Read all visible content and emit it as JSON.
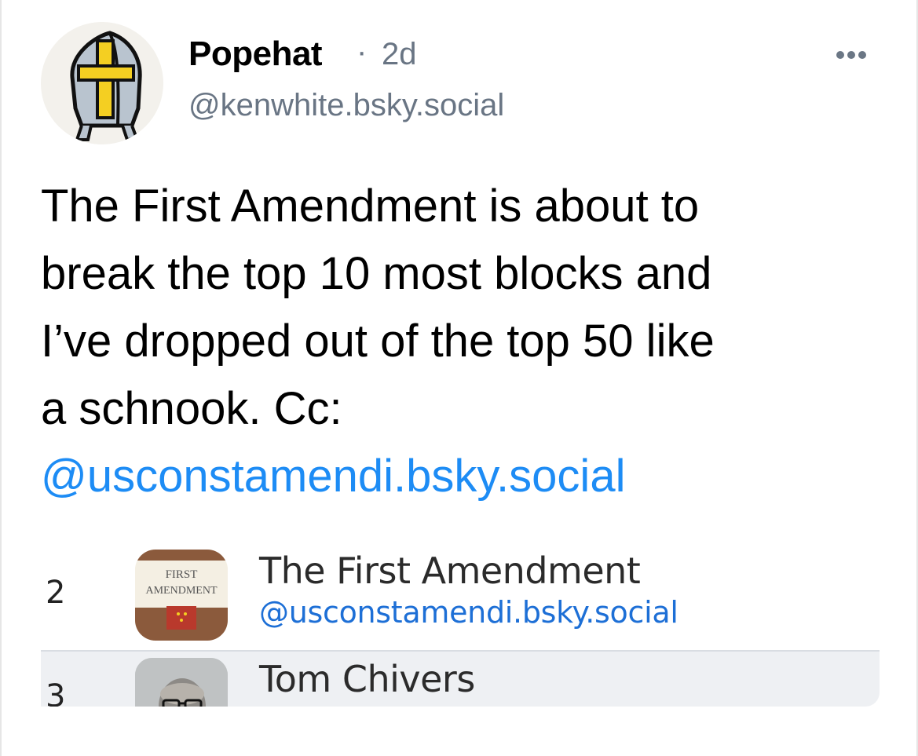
{
  "post": {
    "author_name": "Popehat",
    "separator": "·",
    "age": "2d",
    "handle": "@kenwhite.bsky.social",
    "avatar_icon": "mitre-icon",
    "more_icon": "more-options-icon",
    "text_lines": [
      "The First Amendment is about to",
      "break the top 10 most blocks and",
      "I’ve dropped out of the top 50 like",
      "a schnook.  Cc:"
    ],
    "mention": "@usconstamendi.bsky.social"
  },
  "embed": {
    "rows": [
      {
        "rank": "2",
        "name": "The First Amendment",
        "handle": "@usconstamendi.bsky.social",
        "logo_text_top": "FIRST",
        "logo_text_bottom": "AMENDMENT"
      },
      {
        "rank": "3",
        "name": "Tom Chivers"
      }
    ]
  },
  "colors": {
    "text": "#000000",
    "muted": "#697584",
    "link": "#1d8cf5",
    "embed_link": "#1d6fd6",
    "row_highlight": "#eef0f3"
  }
}
